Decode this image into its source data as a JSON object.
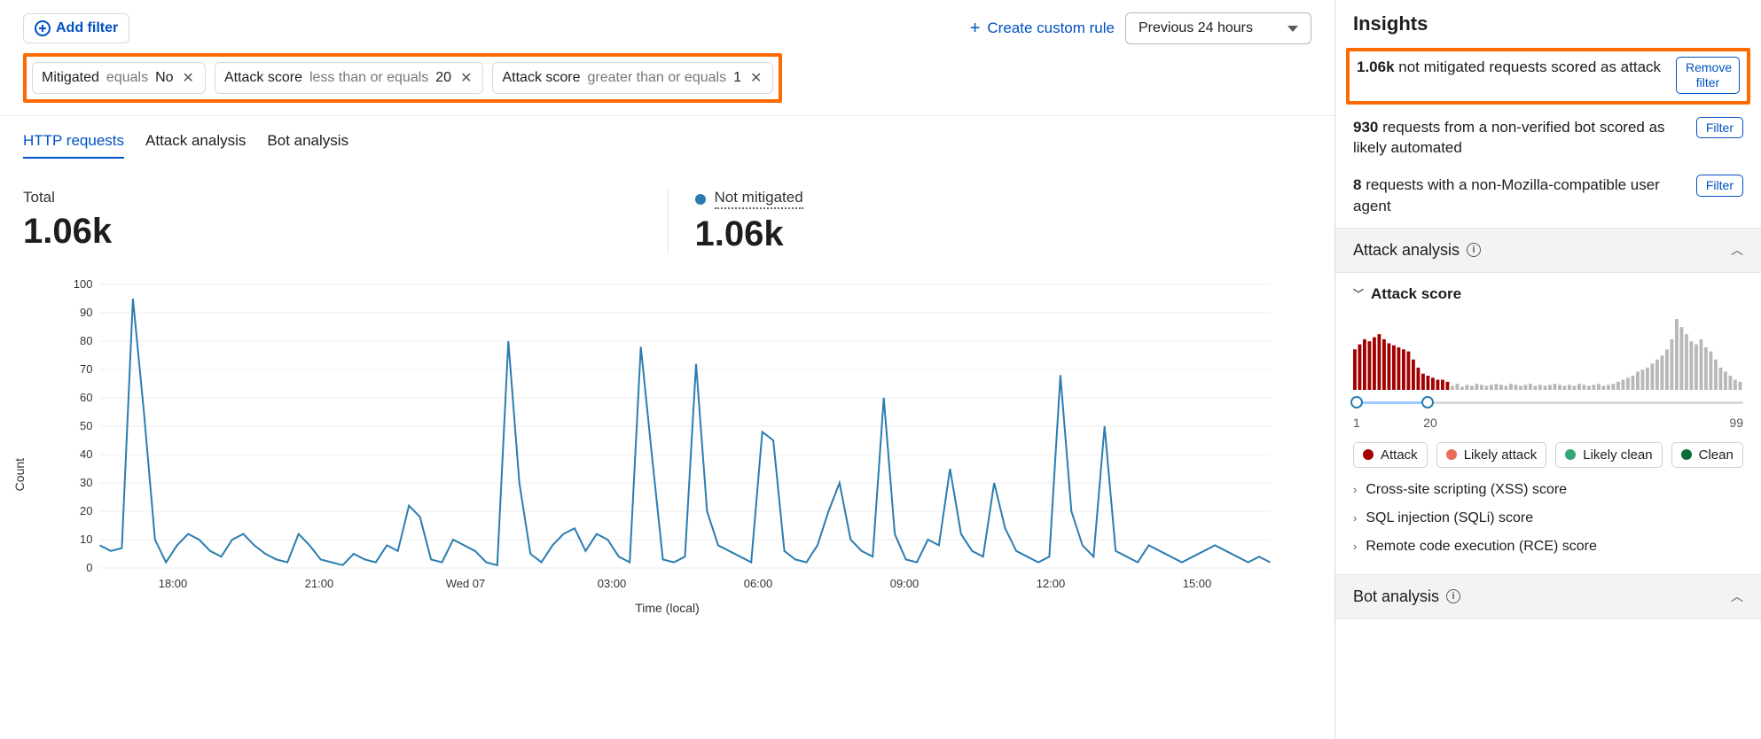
{
  "topbar": {
    "add_filter_label": "Add filter",
    "create_rule_label": "Create custom rule",
    "timerange_label": "Previous 24 hours"
  },
  "filters": [
    {
      "field": "Mitigated",
      "op": "equals",
      "value": "No"
    },
    {
      "field": "Attack score",
      "op": "less than or equals",
      "value": "20"
    },
    {
      "field": "Attack score",
      "op": "greater than or equals",
      "value": "1"
    }
  ],
  "tabs": [
    {
      "label": "HTTP requests",
      "active": true
    },
    {
      "label": "Attack analysis",
      "active": false
    },
    {
      "label": "Bot analysis",
      "active": false
    }
  ],
  "totals": {
    "total_label": "Total",
    "total_value": "1.06k",
    "not_mitigated_label": "Not mitigated",
    "not_mitigated_value": "1.06k"
  },
  "chart_data": {
    "type": "line",
    "x_ticks": [
      "18:00",
      "21:00",
      "Wed 07",
      "03:00",
      "06:00",
      "09:00",
      "12:00",
      "15:00"
    ],
    "y_ticks": [
      0,
      10,
      20,
      30,
      40,
      50,
      60,
      70,
      80,
      90,
      100
    ],
    "ylabel": "Count",
    "xlabel": "Time (local)",
    "ylim": [
      0,
      100
    ],
    "series": [
      {
        "name": "Not mitigated",
        "color": "#2c7cb0",
        "values": [
          8,
          6,
          7,
          95,
          55,
          10,
          2,
          8,
          12,
          10,
          6,
          4,
          10,
          12,
          8,
          5,
          3,
          2,
          12,
          8,
          3,
          2,
          1,
          5,
          3,
          2,
          8,
          6,
          22,
          18,
          3,
          2,
          10,
          8,
          6,
          2,
          1,
          80,
          30,
          5,
          2,
          8,
          12,
          14,
          6,
          12,
          10,
          4,
          2,
          78,
          40,
          3,
          2,
          4,
          72,
          20,
          8,
          6,
          4,
          2,
          48,
          45,
          6,
          3,
          2,
          8,
          20,
          30,
          10,
          6,
          4,
          60,
          12,
          3,
          2,
          10,
          8,
          35,
          12,
          6,
          4,
          30,
          14,
          6,
          4,
          2,
          4,
          68,
          20,
          8,
          4,
          50,
          6,
          4,
          2,
          8,
          6,
          4,
          2,
          4,
          6,
          8,
          6,
          4,
          2,
          4,
          2
        ]
      }
    ]
  },
  "insights": {
    "title": "Insights",
    "items": [
      {
        "count": "1.06k",
        "text": " not mitigated requests scored as attack",
        "button": "Remove filter",
        "highlight": true,
        "btn_twoline": true
      },
      {
        "count": "930",
        "text": " requests from a non-verified bot scored as likely automated",
        "button": "Filter",
        "highlight": false,
        "btn_twoline": false
      },
      {
        "count": "8",
        "text": " requests with a non-Mozilla-compatible user agent",
        "button": "Filter",
        "highlight": false,
        "btn_twoline": false
      }
    ]
  },
  "attack_analysis": {
    "header": "Attack analysis",
    "score_label": "Attack score",
    "range_min": "1",
    "range_mid": "20",
    "range_max": "99",
    "legend": [
      {
        "label": "Attack",
        "color": "#a30000"
      },
      {
        "label": "Likely attack",
        "color": "#e86d5a"
      },
      {
        "label": "Likely clean",
        "color": "#2fa874"
      },
      {
        "label": "Clean",
        "color": "#0b6b3a"
      }
    ],
    "sub_scores": [
      "Cross-site scripting (XSS) score",
      "SQL injection (SQLi) score",
      "Remote code execution (RCE) score"
    ],
    "spark_values_red": [
      40,
      45,
      50,
      48,
      52,
      55,
      50,
      46,
      44,
      42,
      40,
      38,
      30,
      22,
      16,
      14,
      12,
      10,
      10,
      8
    ],
    "spark_values_grey": [
      4,
      6,
      3,
      5,
      4,
      6,
      5,
      4,
      5,
      6,
      5,
      4,
      6,
      5,
      4,
      5,
      6,
      4,
      5,
      4,
      5,
      6,
      5,
      4,
      5,
      4,
      6,
      5,
      4,
      5,
      6,
      4,
      5,
      6,
      8,
      10,
      12,
      14,
      18,
      20,
      22,
      26,
      30,
      34,
      40,
      50,
      70,
      62,
      55,
      48,
      45,
      50,
      42,
      38,
      30,
      22,
      18,
      14,
      10,
      8
    ]
  },
  "bot_analysis": {
    "header": "Bot analysis"
  }
}
